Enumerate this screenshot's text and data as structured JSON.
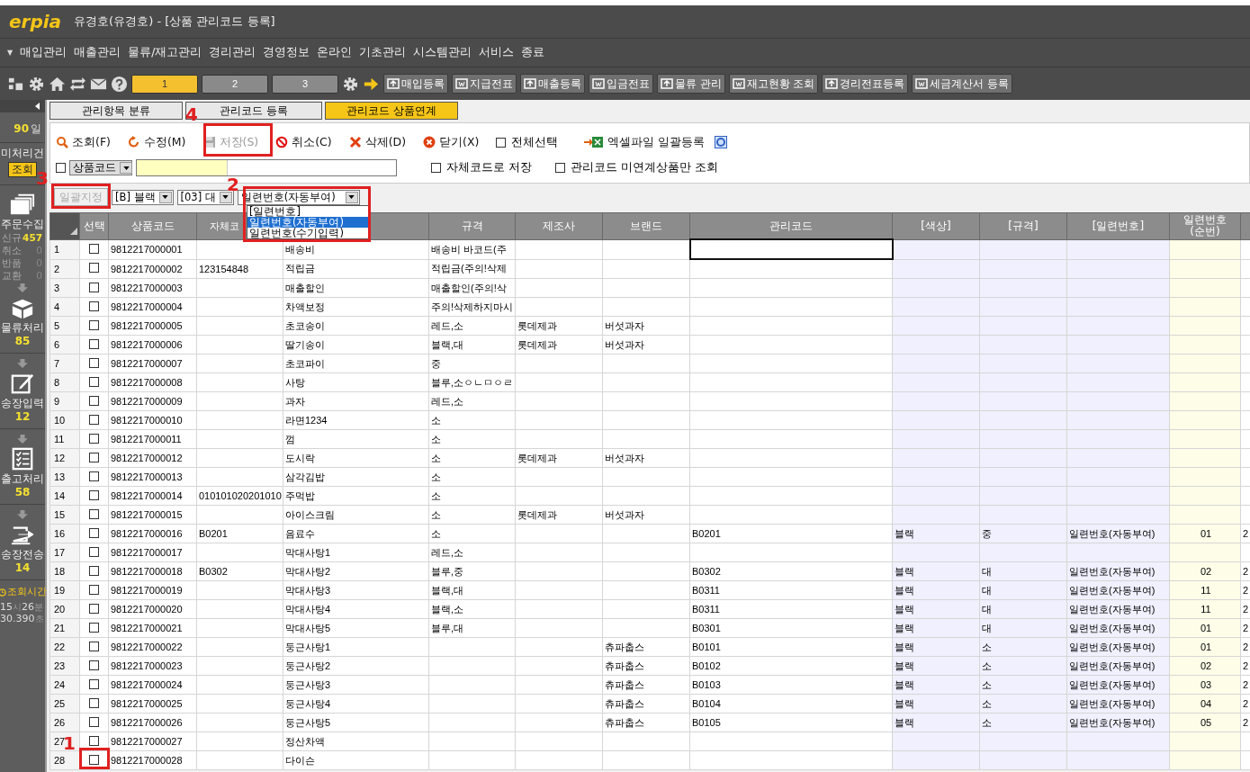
{
  "window": {
    "logo": "erpia",
    "title": "유경호(유경호) - [상품 관리코드 등록]"
  },
  "menu": {
    "caret": "▼",
    "items": [
      "매입관리",
      "매출관리",
      "물류/재고관리",
      "경리관리",
      "경영정보",
      "온라인",
      "기초관리",
      "시스템관리",
      "서비스",
      "종료"
    ]
  },
  "toolbar": {
    "pages": [
      {
        "label": "1",
        "selected": true
      },
      {
        "label": "2",
        "selected": false
      },
      {
        "label": "3",
        "selected": false
      }
    ],
    "buttons": [
      "매입등록",
      "지급전표",
      "매출등록",
      "입금전표",
      "물류 관리",
      "재고현황 조회",
      "경리전표등록",
      "세금계산서 등록"
    ]
  },
  "sidebar": {
    "period": "90",
    "period_unit": "일",
    "pending_label": "미처리건",
    "query_button": "조회",
    "order": {
      "label": "주문수집",
      "stats": [
        {
          "label": "신규",
          "count": "457",
          "highlight": true
        },
        {
          "label": "취소",
          "count": "0",
          "highlight": false
        },
        {
          "label": "반품",
          "count": "0",
          "highlight": false
        },
        {
          "label": "교환",
          "count": "0",
          "highlight": false
        }
      ]
    },
    "steps": [
      {
        "label": "물류처리",
        "count": "85"
      },
      {
        "label": "송장입력",
        "count": "12"
      },
      {
        "label": "출고처리",
        "count": "58"
      },
      {
        "label": "송장전송",
        "count": "14"
      }
    ],
    "time_label": "조회시간",
    "time": [
      {
        "value": "15",
        "unit": "시"
      },
      {
        "value": "26",
        "unit": "분"
      },
      {
        "value": "30.390",
        "unit": "초"
      }
    ]
  },
  "tabs": [
    {
      "label": "관리항목 분류",
      "selected": false
    },
    {
      "label": "관리코드 등록",
      "selected": false
    },
    {
      "label": "관리코드 상품연계",
      "selected": true
    }
  ],
  "actions": [
    {
      "label": "조회(F)",
      "disabled": false
    },
    {
      "label": "수정(M)",
      "disabled": false
    },
    {
      "label": "저장(S)",
      "disabled": true
    },
    {
      "label": "취소(C)",
      "disabled": false
    },
    {
      "label": "삭제(D)",
      "disabled": false
    },
    {
      "label": "닫기(X)",
      "disabled": false
    }
  ],
  "select_all": {
    "label": "전체선택",
    "checked": false
  },
  "excel_button": "엑셀파일 일괄등록",
  "search": {
    "checked": false,
    "field": "상품코드",
    "options": [
      {
        "label": "자체코드로 저장",
        "checked": false
      },
      {
        "label": "관리코드 미연계상품만 조회",
        "checked": false
      }
    ]
  },
  "batch": {
    "button": {
      "label": "일괄지정",
      "disabled": true
    },
    "color_option": "[B] 블랙",
    "size_option": "[03] 대",
    "serial_option": "일련번호(자동부여)",
    "serial_options": [
      {
        "label": "[일련번호]",
        "selected": false
      },
      {
        "label": "일련번호(자동부여)",
        "selected": true
      },
      {
        "label": "일련번호(수기입력)",
        "selected": false
      }
    ]
  },
  "table": {
    "check_header": "선택",
    "columns": [
      {
        "kind": "text",
        "label": "상품코드"
      },
      {
        "kind": "covered",
        "label": "자체코"
      },
      {
        "kind": "text"
      },
      {
        "kind": "text",
        "label": "규격"
      },
      {
        "kind": "text",
        "label": "제조사"
      },
      {
        "kind": "text",
        "label": "브랜드"
      },
      {
        "kind": "edit",
        "label": "관리코드"
      },
      {
        "kind": "option",
        "label": "[색상]"
      },
      {
        "kind": "option",
        "label": "[규격]"
      },
      {
        "kind": "option",
        "label": "[일련번호]"
      },
      {
        "kind": "seq",
        "label": "일련번호(순번)"
      },
      {
        "kind": "text"
      }
    ],
    "rows": [
      {
        "no": "1",
        "checked": false,
        "active": true,
        "cells": [
          "9812217000001",
          "",
          "배송비",
          "배송비 바코드(주",
          "",
          "",
          "",
          "",
          "",
          "",
          "",
          ""
        ]
      },
      {
        "no": "2",
        "checked": false,
        "active": false,
        "cells": [
          "9812217000002",
          "123154848",
          "적립금",
          "적립금(주의!삭제",
          "",
          "",
          "",
          "",
          "",
          "",
          "",
          ""
        ]
      },
      {
        "no": "3",
        "checked": false,
        "active": false,
        "cells": [
          "9812217000003",
          "",
          "매출할인",
          "매출할인(주의!삭",
          "",
          "",
          "",
          "",
          "",
          "",
          "",
          ""
        ]
      },
      {
        "no": "4",
        "checked": false,
        "active": false,
        "cells": [
          "9812217000004",
          "",
          "차액보정",
          "주의!삭제하지마시",
          "",
          "",
          "",
          "",
          "",
          "",
          "",
          ""
        ]
      },
      {
        "no": "5",
        "checked": false,
        "active": false,
        "cells": [
          "9812217000005",
          "",
          "초코송이",
          "레드,소",
          "롯데제과",
          "버섯과자",
          "",
          "",
          "",
          "",
          "",
          ""
        ]
      },
      {
        "no": "6",
        "checked": false,
        "active": false,
        "cells": [
          "9812217000006",
          "",
          "딸기송이",
          "블랙,대",
          "롯데제과",
          "버섯과자",
          "",
          "",
          "",
          "",
          "",
          ""
        ]
      },
      {
        "no": "7",
        "checked": false,
        "active": false,
        "cells": [
          "9812217000007",
          "",
          "초코파이",
          "중",
          "",
          "",
          "",
          "",
          "",
          "",
          "",
          ""
        ]
      },
      {
        "no": "8",
        "checked": false,
        "active": false,
        "cells": [
          "9812217000008",
          "",
          "사탕",
          "블루,소ㅇㄴㅁㅇㄹ",
          "",
          "",
          "",
          "",
          "",
          "",
          "",
          ""
        ]
      },
      {
        "no": "9",
        "checked": false,
        "active": false,
        "cells": [
          "9812217000009",
          "",
          "과자",
          "레드,소",
          "",
          "",
          "",
          "",
          "",
          "",
          "",
          ""
        ]
      },
      {
        "no": "10",
        "checked": false,
        "active": false,
        "cells": [
          "9812217000010",
          "",
          "라면1234",
          "소",
          "",
          "",
          "",
          "",
          "",
          "",
          "",
          ""
        ]
      },
      {
        "no": "11",
        "checked": false,
        "active": false,
        "cells": [
          "9812217000011",
          "",
          "껌",
          "소",
          "",
          "",
          "",
          "",
          "",
          "",
          "",
          ""
        ]
      },
      {
        "no": "12",
        "checked": false,
        "active": false,
        "cells": [
          "9812217000012",
          "",
          "도시락",
          "소",
          "롯데제과",
          "버섯과자",
          "",
          "",
          "",
          "",
          "",
          ""
        ]
      },
      {
        "no": "13",
        "checked": false,
        "active": false,
        "cells": [
          "9812217000013",
          "",
          "삼각김밥",
          "소",
          "",
          "",
          "",
          "",
          "",
          "",
          "",
          ""
        ]
      },
      {
        "no": "14",
        "checked": false,
        "active": false,
        "cells": [
          "9812217000014",
          "010101020201010",
          "주먹밥",
          "소",
          "",
          "",
          "",
          "",
          "",
          "",
          "",
          ""
        ]
      },
      {
        "no": "15",
        "checked": false,
        "active": false,
        "cells": [
          "9812217000015",
          "",
          "아이스크림",
          "소",
          "롯데제과",
          "버섯과자",
          "",
          "",
          "",
          "",
          "",
          ""
        ]
      },
      {
        "no": "16",
        "checked": false,
        "active": false,
        "cells": [
          "9812217000016",
          "B0201",
          "음료수",
          "소",
          "",
          "",
          "B0201",
          "블랙",
          "중",
          "일련번호(자동부여)",
          "01",
          "2"
        ]
      },
      {
        "no": "17",
        "checked": false,
        "active": false,
        "cells": [
          "9812217000017",
          "",
          "막대사탕1",
          "레드,소",
          "",
          "",
          "",
          "",
          "",
          "",
          "",
          ""
        ]
      },
      {
        "no": "18",
        "checked": false,
        "active": false,
        "cells": [
          "9812217000018",
          "B0302",
          "막대사탕2",
          "블루,중",
          "",
          "",
          "B0302",
          "블랙",
          "대",
          "일련번호(자동부여)",
          "02",
          "2"
        ]
      },
      {
        "no": "19",
        "checked": false,
        "active": false,
        "cells": [
          "9812217000019",
          "",
          "막대사탕3",
          "블랙,대",
          "",
          "",
          "B0311",
          "블랙",
          "대",
          "일련번호(자동부여)",
          "11",
          "2"
        ]
      },
      {
        "no": "20",
        "checked": false,
        "active": false,
        "cells": [
          "9812217000020",
          "",
          "막대사탕4",
          "블랙,소",
          "",
          "",
          "B0311",
          "블랙",
          "대",
          "일련번호(자동부여)",
          "11",
          "2"
        ]
      },
      {
        "no": "21",
        "checked": false,
        "active": false,
        "cells": [
          "9812217000021",
          "",
          "막대사탕5",
          "블루,대",
          "",
          "",
          "B0301",
          "블랙",
          "대",
          "일련번호(자동부여)",
          "01",
          "2"
        ]
      },
      {
        "no": "22",
        "checked": false,
        "active": false,
        "cells": [
          "9812217000022",
          "",
          "둥근사탕1",
          "",
          "",
          "츄파춥스",
          "B0101",
          "블랙",
          "소",
          "일련번호(자동부여)",
          "01",
          "2"
        ]
      },
      {
        "no": "23",
        "checked": false,
        "active": false,
        "cells": [
          "9812217000023",
          "",
          "둥근사탕2",
          "",
          "",
          "츄파춥스",
          "B0102",
          "블랙",
          "소",
          "일련번호(자동부여)",
          "02",
          "2"
        ]
      },
      {
        "no": "24",
        "checked": false,
        "active": false,
        "cells": [
          "9812217000024",
          "",
          "둥근사탕3",
          "",
          "",
          "츄파춥스",
          "B0103",
          "블랙",
          "소",
          "일련번호(자동부여)",
          "03",
          "2"
        ]
      },
      {
        "no": "25",
        "checked": false,
        "active": false,
        "cells": [
          "9812217000025",
          "",
          "둥근사탕4",
          "",
          "",
          "츄파춥스",
          "B0104",
          "블랙",
          "소",
          "일련번호(자동부여)",
          "04",
          "2"
        ]
      },
      {
        "no": "26",
        "checked": false,
        "active": false,
        "cells": [
          "9812217000026",
          "",
          "둥근사탕5",
          "",
          "",
          "츄파춥스",
          "B0105",
          "블랙",
          "소",
          "일련번호(자동부여)",
          "05",
          "2"
        ]
      },
      {
        "no": "27",
        "checked": false,
        "active": false,
        "cells": [
          "9812217000027",
          "",
          "정산차액",
          "",
          "",
          "",
          "",
          "",
          "",
          "",
          "",
          ""
        ]
      },
      {
        "no": "28",
        "checked": false,
        "active": false,
        "cells": [
          "9812217000028",
          "",
          "다이슨",
          "",
          "",
          "",
          "",
          "",
          "",
          "",
          "",
          ""
        ]
      }
    ]
  },
  "annotations": [
    "1",
    "2",
    "3",
    "4"
  ]
}
